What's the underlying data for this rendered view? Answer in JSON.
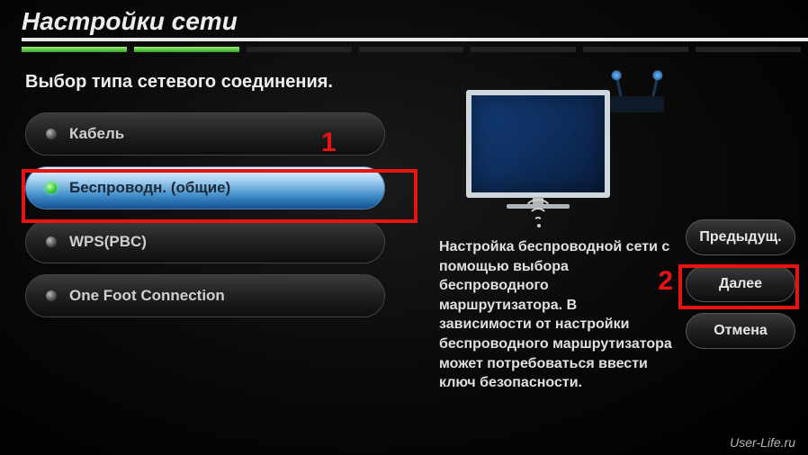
{
  "header": {
    "title": "Настройки сети"
  },
  "subtitle": "Выбор типа сетевого соединения.",
  "options": [
    {
      "label": "Кабель",
      "selected": false
    },
    {
      "label": "Беспроводн. (общие)",
      "selected": true
    },
    {
      "label": "WPS(PBC)",
      "selected": false
    },
    {
      "label": "One Foot Connection",
      "selected": false
    }
  ],
  "description": "Настройка беспроводной сети с помощью выбора беспроводного маршрутизатора. В зависимости от настройки беспроводного маршрутизатора может потребоваться ввести ключ безопасности.",
  "nav": {
    "prev": "Предыдущ.",
    "next": "Далее",
    "cancel": "Отмена"
  },
  "callouts": {
    "c1": "1",
    "c2": "2"
  },
  "watermark": "User-Life.ru"
}
